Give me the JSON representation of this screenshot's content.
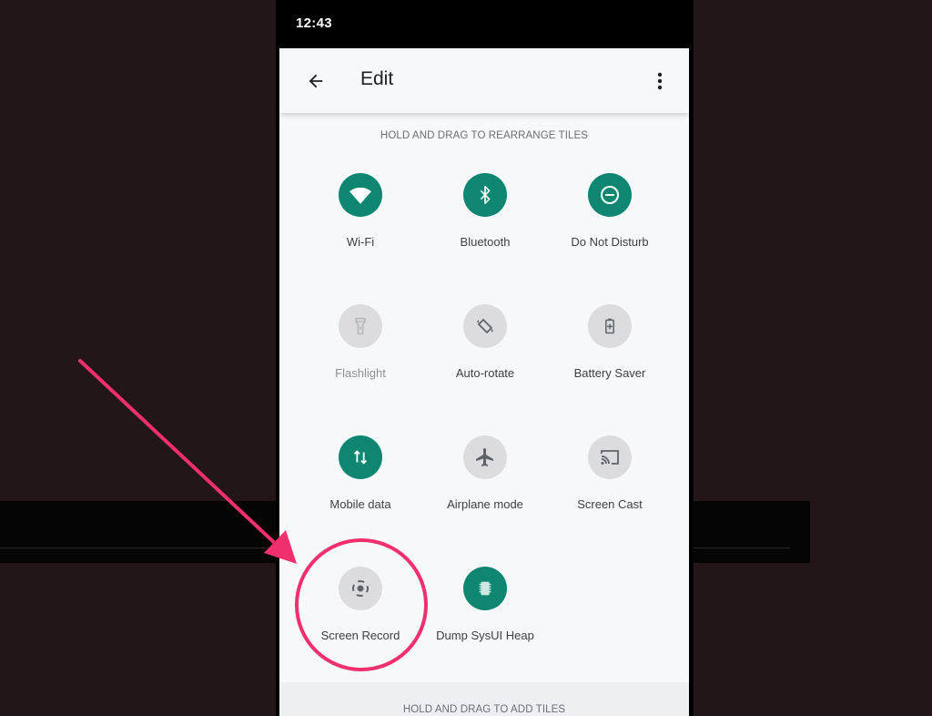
{
  "status_bar": {
    "time": "12:43"
  },
  "header": {
    "title": "Edit",
    "back_icon": "arrow-back-icon",
    "more_icon": "more-vert-icon"
  },
  "sections": {
    "rearrange_label": "HOLD AND DRAG TO REARRANGE TILES",
    "add_label": "HOLD AND DRAG TO ADD TILES"
  },
  "colors": {
    "tile_on": "#0f8672",
    "tile_off": "#dcdcde",
    "annotation": "#f0306e"
  },
  "tiles": [
    {
      "label": "Wi-Fi",
      "icon": "wifi-icon",
      "state": "on"
    },
    {
      "label": "Bluetooth",
      "icon": "bluetooth-icon",
      "state": "on"
    },
    {
      "label": "Do Not Disturb",
      "icon": "do-not-disturb-icon",
      "state": "on"
    },
    {
      "label": "Flashlight",
      "icon": "flashlight-icon",
      "state": "unavailable"
    },
    {
      "label": "Auto-rotate",
      "icon": "auto-rotate-icon",
      "state": "off"
    },
    {
      "label": "Battery Saver",
      "icon": "battery-saver-icon",
      "state": "off"
    },
    {
      "label": "Mobile data",
      "icon": "mobile-data-icon",
      "state": "on"
    },
    {
      "label": "Airplane mode",
      "icon": "airplane-icon",
      "state": "off"
    },
    {
      "label": "Screen Cast",
      "icon": "cast-icon",
      "state": "off"
    },
    {
      "label": "Screen Record",
      "icon": "screen-record-icon",
      "state": "off",
      "highlighted": true
    },
    {
      "label": "Dump SysUI Heap",
      "icon": "memory-chip-icon",
      "state": "on"
    }
  ]
}
